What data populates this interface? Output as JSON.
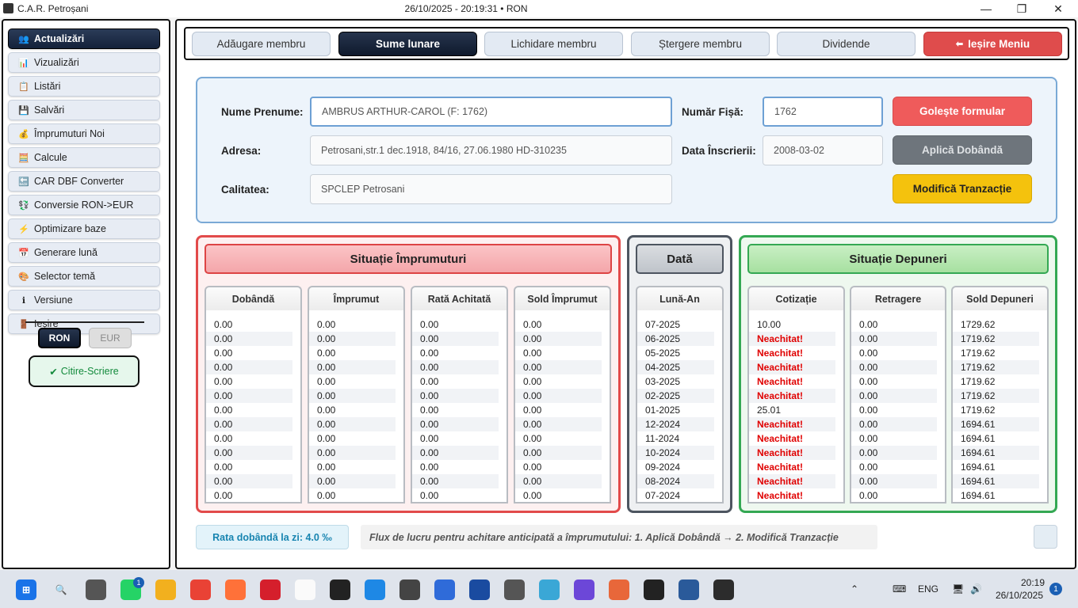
{
  "window": {
    "title": "C.A.R. Petroșani",
    "center_info": "26/10/2025 - 20:19:31 • RON",
    "minimize_glyph": "—",
    "maximize_glyph": "❐",
    "close_glyph": "✕"
  },
  "sidebar": {
    "items": [
      {
        "label": "Actualizări",
        "icon": "users-icon",
        "glyph": "👥"
      },
      {
        "label": "Vizualizări",
        "icon": "bar-chart-icon",
        "glyph": "📊"
      },
      {
        "label": "Listări",
        "icon": "clipboard-icon",
        "glyph": "📋"
      },
      {
        "label": "Salvări",
        "icon": "floppy-disk-icon",
        "glyph": "💾"
      },
      {
        "label": "Împrumuturi Noi",
        "icon": "money-bag-icon",
        "glyph": "💰"
      },
      {
        "label": "Calcule",
        "icon": "calculator-icon",
        "glyph": "🧮"
      },
      {
        "label": "CAR DBF Converter",
        "icon": "back-arrow-icon",
        "glyph": "🔙"
      },
      {
        "label": "Conversie RON->EUR",
        "icon": "currency-exchange-icon",
        "glyph": "💱"
      },
      {
        "label": "Optimizare baze",
        "icon": "lightning-icon",
        "glyph": "⚡"
      },
      {
        "label": "Generare lună",
        "icon": "calendar-icon",
        "glyph": "📅"
      },
      {
        "label": "Selector temă",
        "icon": "palette-icon",
        "glyph": "🎨"
      },
      {
        "label": "Versiune",
        "icon": "info-icon",
        "glyph": "ℹ"
      },
      {
        "label": "Ieșire",
        "icon": "door-icon",
        "glyph": "🚪"
      }
    ],
    "currency_ron": "RON",
    "currency_eur": "EUR",
    "mode_label": "Citire-Scriere",
    "mode_glyph": "✔"
  },
  "nav": {
    "buttons": [
      "Adăugare membru",
      "Sume lunare",
      "Lichidare membru",
      "Ștergere membru",
      "Dividende"
    ],
    "exit_label": "Ieșire Meniu",
    "exit_glyph": "⬅"
  },
  "form": {
    "name_label": "Nume Prenume:",
    "name_value": "AMBRUS ARTHUR-CAROL (F: 1762)",
    "fisa_label": "Număr Fișă:",
    "fisa_value": "1762",
    "address_label": "Adresa:",
    "address_value": "Petrosani,str.1 dec.1918, 84/16,  27.06.1980 HD-310235",
    "date_label": "Data Înscrierii:",
    "date_value": "2008-03-02",
    "quality_label": "Calitatea:",
    "quality_value": "SPCLEP Petrosani",
    "btn_clear": "Golește formular",
    "btn_interest": "Aplică Dobândă",
    "btn_modify": "Modifică Tranzacție"
  },
  "loans": {
    "title": "Situație Împrumuturi",
    "columns": [
      "Dobândă",
      "Împrumut",
      "Rată Achitată",
      "Sold Împrumut"
    ],
    "dobanda": [
      "0.00",
      "0.00",
      "0.00",
      "0.00",
      "0.00",
      "0.00",
      "0.00",
      "0.00",
      "0.00",
      "0.00",
      "0.00",
      "0.00",
      "0.00"
    ],
    "imprumut": [
      "0.00",
      "0.00",
      "0.00",
      "0.00",
      "0.00",
      "0.00",
      "0.00",
      "0.00",
      "0.00",
      "0.00",
      "0.00",
      "0.00",
      "0.00"
    ],
    "rata": [
      "0.00",
      "0.00",
      "0.00",
      "0.00",
      "0.00",
      "0.00",
      "0.00",
      "0.00",
      "0.00",
      "0.00",
      "0.00",
      "0.00",
      "0.00"
    ],
    "sold": [
      "0.00",
      "0.00",
      "0.00",
      "0.00",
      "0.00",
      "0.00",
      "0.00",
      "0.00",
      "0.00",
      "0.00",
      "0.00",
      "0.00",
      "0.00"
    ]
  },
  "dates": {
    "title": "Dată",
    "column": "Lună-An",
    "values": [
      "07-2025",
      "06-2025",
      "05-2025",
      "04-2025",
      "03-2025",
      "02-2025",
      "01-2025",
      "12-2024",
      "11-2024",
      "10-2024",
      "09-2024",
      "08-2024",
      "07-2024"
    ]
  },
  "deposits": {
    "title": "Situație Depuneri",
    "columns": [
      "Cotizație",
      "Retragere",
      "Sold Depuneri"
    ],
    "cotizatie": [
      "10.00",
      "Neachitat!",
      "Neachitat!",
      "Neachitat!",
      "Neachitat!",
      "Neachitat!",
      "25.01",
      "Neachitat!",
      "Neachitat!",
      "Neachitat!",
      "Neachitat!",
      "Neachitat!",
      "Neachitat!"
    ],
    "retragere": [
      "0.00",
      "0.00",
      "0.00",
      "0.00",
      "0.00",
      "0.00",
      "0.00",
      "0.00",
      "0.00",
      "0.00",
      "0.00",
      "0.00",
      "0.00"
    ],
    "sold": [
      "1729.62",
      "1719.62",
      "1719.62",
      "1719.62",
      "1719.62",
      "1719.62",
      "1719.62",
      "1694.61",
      "1694.61",
      "1694.61",
      "1694.61",
      "1694.61",
      "1694.61"
    ]
  },
  "footer": {
    "rate": "Rata dobândă la zi: 4.0 ‰",
    "flux": "Flux de lucru pentru achitare anticipată a împrumutului: 1. Aplică Dobândă → 2. Modifică Tranzacție"
  },
  "taskbar": {
    "whatsapp_badge": "1",
    "lang": "ENG",
    "time": "20:19",
    "date": "26/10/2025",
    "notif": "1"
  }
}
